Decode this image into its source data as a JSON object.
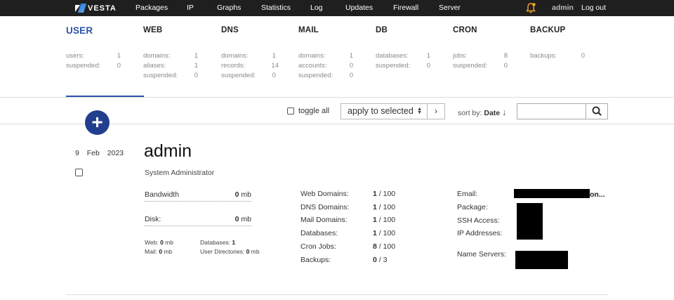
{
  "brand": {
    "name": "VESTA"
  },
  "nav": [
    "Packages",
    "IP",
    "Graphs",
    "Statistics",
    "Log",
    "Updates",
    "Firewall",
    "Server"
  ],
  "header": {
    "user": "admin",
    "logout": "Log out"
  },
  "tabs": [
    {
      "title": "USER",
      "stats": [
        {
          "label": "users:",
          "value": "1"
        },
        {
          "label": "suspended:",
          "value": "0"
        }
      ]
    },
    {
      "title": "WEB",
      "stats": [
        {
          "label": "domains:",
          "value": "1"
        },
        {
          "label": "aliases:",
          "value": "1"
        },
        {
          "label": "suspended:",
          "value": "0"
        }
      ]
    },
    {
      "title": "DNS",
      "stats": [
        {
          "label": "domains:",
          "value": "1"
        },
        {
          "label": "records:",
          "value": "14"
        },
        {
          "label": "suspended:",
          "value": "0"
        }
      ]
    },
    {
      "title": "MAIL",
      "stats": [
        {
          "label": "domains:",
          "value": "1"
        },
        {
          "label": "accounts:",
          "value": "0"
        },
        {
          "label": "suspended:",
          "value": "0"
        }
      ]
    },
    {
      "title": "DB",
      "stats": [
        {
          "label": "databases:",
          "value": "1"
        },
        {
          "label": "suspended:",
          "value": "0"
        }
      ]
    },
    {
      "title": "CRON",
      "stats": [
        {
          "label": "jobs:",
          "value": "8"
        },
        {
          "label": "suspended:",
          "value": "0"
        }
      ]
    },
    {
      "title": "BACKUP",
      "stats": [
        {
          "label": "backups:",
          "value": "0"
        }
      ]
    }
  ],
  "toolbar": {
    "toggle_all": "toggle all",
    "apply_selected": "apply to selected",
    "apply_arrows": "▲▼",
    "go": "›",
    "sort_by_label": "sort by:",
    "sort_by_value": "Date",
    "sort_arrow": "↓",
    "search_placeholder": "",
    "add": "+"
  },
  "user": {
    "date_day": "9",
    "date_month": "Feb",
    "date_year": "2023",
    "username": "admin",
    "fullname": "System Administrator",
    "bandwidth_label": "Bandwidth",
    "bandwidth_value": "0",
    "bandwidth_unit": "mb",
    "disk_label": "Disk:",
    "disk_value": "0",
    "disk_unit": "mb",
    "disk_breakdown": [
      {
        "label": "Web:",
        "value": "0",
        "unit": "mb"
      },
      {
        "label": "Mail:",
        "value": "0",
        "unit": "mb"
      },
      {
        "label": "Databases:",
        "value": "1",
        "unit": ""
      },
      {
        "label": "User Directories:",
        "value": "0",
        "unit": "mb"
      }
    ],
    "quotas": [
      {
        "label": "Web Domains:",
        "used": "1",
        "limit": "100"
      },
      {
        "label": "DNS Domains:",
        "used": "1",
        "limit": "100"
      },
      {
        "label": "Mail Domains:",
        "used": "1",
        "limit": "100"
      },
      {
        "label": "Databases:",
        "used": "1",
        "limit": "100"
      },
      {
        "label": "Cron Jobs:",
        "used": "8",
        "limit": "100"
      },
      {
        "label": "Backups:",
        "used": "0",
        "limit": "3"
      }
    ],
    "info_labels": {
      "email": "Email:",
      "package": "Package:",
      "ssh": "SSH Access:",
      "ip": "IP Addresses:",
      "ns": "Name Servers:"
    },
    "email_tail": "on..."
  },
  "colors": {
    "accent": "#2c54ac",
    "add_button": "#223f8f",
    "nav_bg": "#1f1f1f",
    "bell": "#f5a623"
  }
}
